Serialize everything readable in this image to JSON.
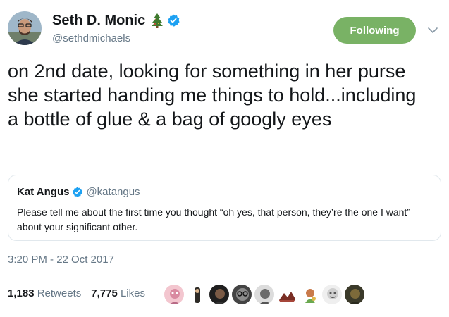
{
  "author": {
    "display_name": "Seth D. Monic",
    "handle": "@sethdmichaels",
    "badge_icon": "christmas-tree-icon",
    "verified_icon": "verified-badge-icon"
  },
  "follow_button": {
    "label": "Following",
    "color": "#79b265"
  },
  "tweet": {
    "text": "on 2nd date, looking for something in her purse she started handing me things to hold...including a bottle of glue & a bag of googly eyes",
    "timestamp": "3:20 PM - 22 Oct 2017"
  },
  "quoted_tweet": {
    "display_name": "Kat Angus",
    "handle": "@katangus",
    "text": "Please tell me about the first time you thought “oh yes, that person, they’re the one I want” about your significant other."
  },
  "stats": {
    "retweets_count": "1,183",
    "retweets_label": "Retweets",
    "likes_count": "7,775",
    "likes_label": "Likes"
  },
  "likers": [
    {
      "name": "liker-avatar-1"
    },
    {
      "name": "liker-avatar-2"
    },
    {
      "name": "liker-avatar-3"
    },
    {
      "name": "liker-avatar-4"
    },
    {
      "name": "liker-avatar-5"
    },
    {
      "name": "liker-avatar-6"
    },
    {
      "name": "liker-avatar-7"
    },
    {
      "name": "liker-avatar-8"
    },
    {
      "name": "liker-avatar-9"
    }
  ],
  "colors": {
    "text": "#14171a",
    "secondary": "#657786",
    "verified": "#1da1f2",
    "border": "#e1e8ed"
  }
}
